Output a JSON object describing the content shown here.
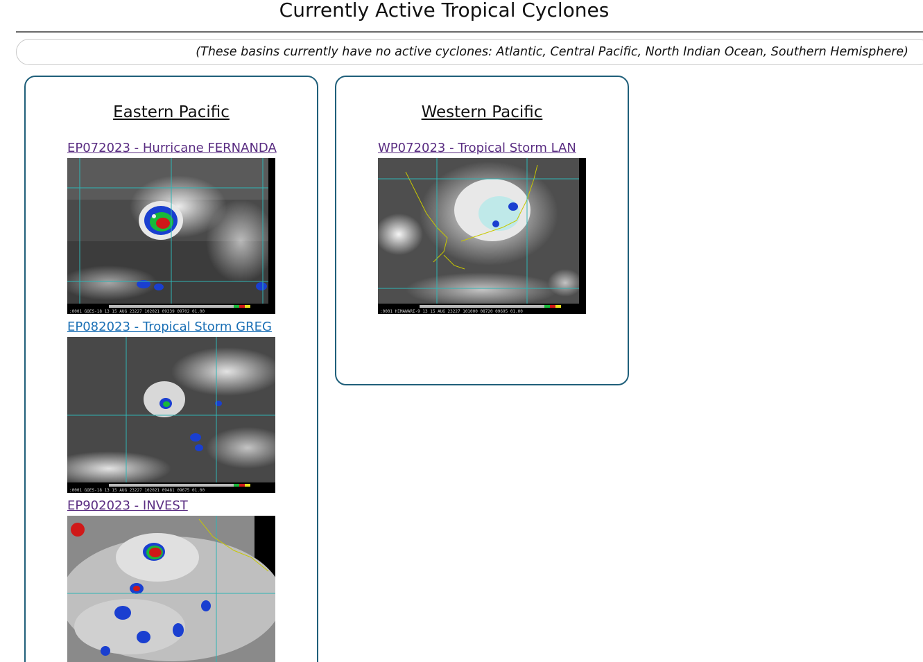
{
  "page": {
    "title": "Currently Active Tropical Cyclones",
    "inactive_notice": "(These basins currently have no active cyclones: Atlantic, Central Pacific, North Indian Ocean, Southern Hemisphere)"
  },
  "basins": [
    {
      "name": "Eastern Pacific",
      "storms": [
        {
          "label": "EP072023 - Hurricane FERNANDA",
          "image_caption": ":0001 GOES-18   13 15 AUG 23227 102021 09339 09702 01.00"
        },
        {
          "label": "EP082023 - Tropical Storm GREG",
          "image_caption": ":0001 GOES-18   13 15 AUG 23227 102021 09481 09675 01.00"
        },
        {
          "label": "EP902023 - INVEST"
        }
      ]
    },
    {
      "name": "Western Pacific",
      "storms": [
        {
          "label": "WP072023 - Tropical Storm LAN",
          "image_caption": ":0001 HIMAWARI-9 13 15 AUG 23227 101000 08720 09695 01.00"
        }
      ]
    }
  ],
  "colors": {
    "card_border": "#1f5f7a",
    "visited_link": "#5a2d82",
    "unvisited_link": "#1a6fb5",
    "title_rule": "#6a6a6a"
  }
}
